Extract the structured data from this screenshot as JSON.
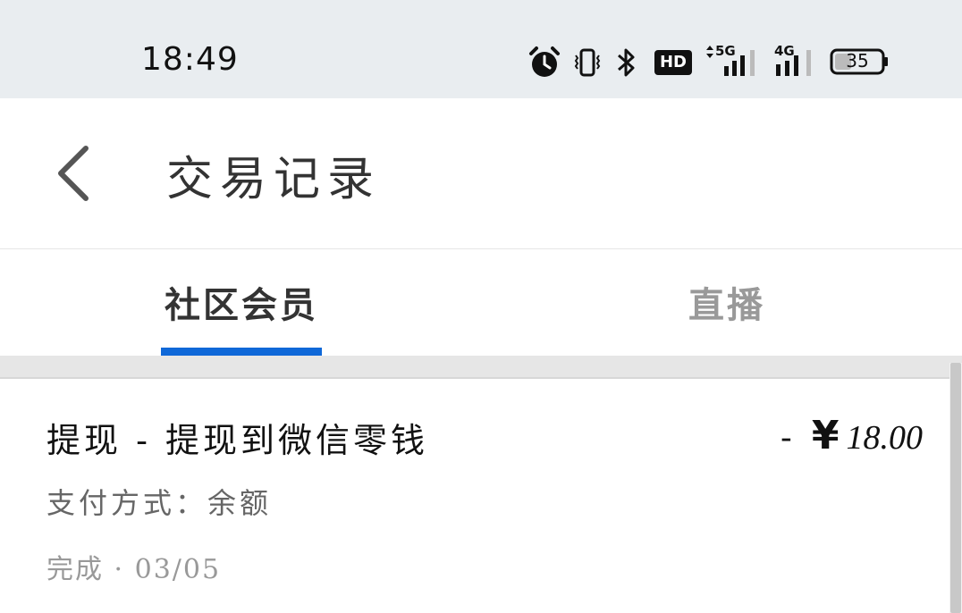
{
  "status_bar": {
    "time": "18:49",
    "icons": [
      "alarm-icon",
      "vibrate-icon",
      "bluetooth-icon",
      "hd-icon",
      "5g-signal-icon",
      "4g-signal-icon",
      "battery-icon"
    ],
    "hd_label": "HD",
    "net1_label": "5G",
    "net2_label": "4G",
    "battery_level": "35"
  },
  "header": {
    "back_icon": "chevron-left-icon",
    "title": "交易记录"
  },
  "tabs": [
    {
      "label": "社区会员",
      "active": true
    },
    {
      "label": "直播",
      "active": false
    }
  ],
  "colors": {
    "accent": "#0f68d8",
    "status_bar_bg": "#e9edf0",
    "divider": "#e6e6e6"
  },
  "transactions": [
    {
      "title": "提现 - 提现到微信零钱",
      "sign": "-",
      "currency": "¥",
      "amount": "18.00",
      "payment": "支付方式：余额",
      "status": "完成 · 03/05"
    }
  ]
}
